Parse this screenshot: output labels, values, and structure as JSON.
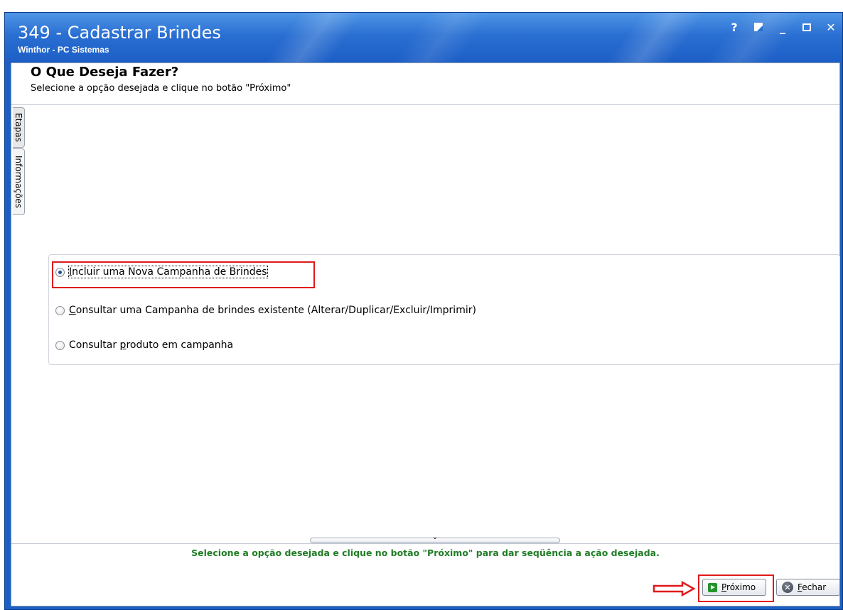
{
  "window": {
    "title": "349 - Cadastrar Brindes",
    "subtitle": "Winthor - PC Sistemas",
    "controls": {
      "help": "?",
      "minimize": "_",
      "close": "✕"
    }
  },
  "header": {
    "title": "O Que Deseja Fazer?",
    "instruction": "Selecione a opção desejada e clique no botão \"Próximo\""
  },
  "side_tabs": [
    "Etapas",
    "Informações"
  ],
  "options": {
    "items": [
      {
        "mnemonic": "I",
        "rest": "ncluir uma Nova Campanha de Brindes",
        "checked": true
      },
      {
        "mnemonic": "C",
        "rest": "onsultar uma Campanha de brindes existente (Alterar/Duplicar/Excluir/Imprimir)",
        "checked": false
      },
      {
        "before": "Consultar ",
        "mnemonic": "p",
        "rest": "roduto em campanha",
        "checked": false
      }
    ]
  },
  "status": {
    "hint": "Selecione a opção desejada e clique no botão \"Próximo\" para dar seqüência a ação desejada."
  },
  "footer": {
    "next": {
      "mnemonic": "P",
      "rest": "róximo"
    },
    "close": {
      "mnemonic": "F",
      "rest": "echar"
    }
  },
  "colors": {
    "titlebar": "#2a6fd2",
    "highlight": "#e01a1a",
    "hint_text": "#1f7d25"
  }
}
